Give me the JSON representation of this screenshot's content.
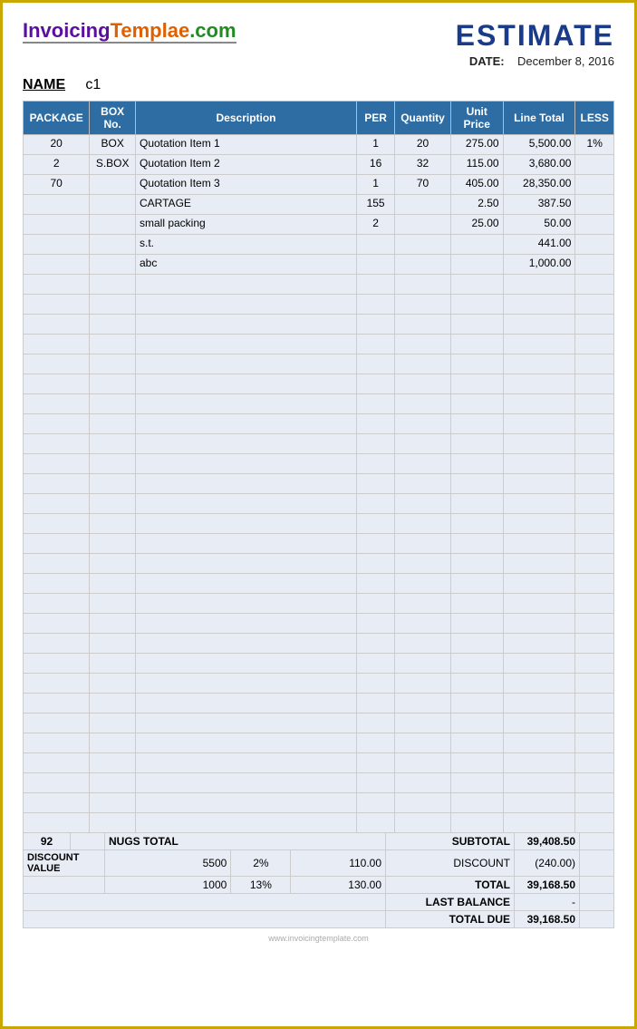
{
  "logo": {
    "part1": "Invoicing",
    "part2": "Templae",
    "part3": ".com"
  },
  "header": {
    "title": "ESTIMATE",
    "date_label": "DATE:",
    "date_value": "December 8, 2016"
  },
  "name_label": "NAME",
  "name_value": "c1",
  "table": {
    "headers": {
      "package": "PACKAGE",
      "box_no": "BOX No.",
      "description": "Description",
      "per": "PER",
      "quantity": "Quantity",
      "unit_price": "Unit Price",
      "line_total": "Line Total",
      "less": "LESS"
    },
    "rows": [
      {
        "package": "20",
        "box": "BOX",
        "description": "Quotation Item 1",
        "per": "1",
        "quantity": "20",
        "unit_price": "275.00",
        "line_total": "5,500.00",
        "less": "1%"
      },
      {
        "package": "2",
        "box": "S.BOX",
        "description": "Quotation Item 2",
        "per": "16",
        "quantity": "32",
        "unit_price": "115.00",
        "line_total": "3,680.00",
        "less": ""
      },
      {
        "package": "70",
        "box": "",
        "description": "Quotation Item 3",
        "per": "1",
        "quantity": "70",
        "unit_price": "405.00",
        "line_total": "28,350.00",
        "less": ""
      },
      {
        "package": "",
        "box": "",
        "description": "CARTAGE",
        "per": "155",
        "quantity": "",
        "unit_price": "2.50",
        "line_total": "387.50",
        "less": ""
      },
      {
        "package": "",
        "box": "",
        "description": "small packing",
        "per": "2",
        "quantity": "",
        "unit_price": "25.00",
        "line_total": "50.00",
        "less": ""
      },
      {
        "package": "",
        "box": "",
        "description": "s.t.",
        "per": "",
        "quantity": "",
        "unit_price": "",
        "line_total": "441.00",
        "less": ""
      },
      {
        "package": "",
        "box": "",
        "description": "abc",
        "per": "",
        "quantity": "",
        "unit_price": "",
        "line_total": "1,000.00",
        "less": ""
      }
    ],
    "empty_rows": 28
  },
  "footer": {
    "nugs_total_qty": "92",
    "nugs_total_label": "NUGS TOTAL",
    "subtotal_label": "SUBTOTAL",
    "subtotal_value": "39,408.50",
    "discount_value_label": "DISCOUNT VALUE",
    "discount_row1_val": "5500",
    "discount_row1_pct": "2%",
    "discount_row1_amt": "110.00",
    "discount_row2_val": "1000",
    "discount_row2_pct": "13%",
    "discount_row2_amt": "130.00",
    "discount_label": "DISCOUNT",
    "discount_total": "(240.00)",
    "total_label": "TOTAL",
    "total_value": "39,168.50",
    "last_balance_label": "LAST BALANCE",
    "last_balance_value": "-",
    "total_due_label": "TOTAL DUE",
    "total_due_value": "39,168.50"
  },
  "watermark": "www.invoicingtemplate.com"
}
